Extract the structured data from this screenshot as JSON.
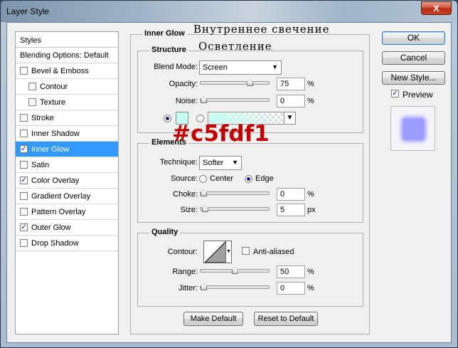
{
  "window": {
    "title": "Layer Style",
    "close_glyph": "X"
  },
  "styles_panel": {
    "header": "Styles",
    "items": [
      {
        "label": "Blending Options: Default",
        "has_checkbox": false,
        "checked": false,
        "indent": false,
        "selected": false
      },
      {
        "label": "Bevel & Emboss",
        "has_checkbox": true,
        "checked": false,
        "indent": false,
        "selected": false
      },
      {
        "label": "Contour",
        "has_checkbox": true,
        "checked": false,
        "indent": true,
        "selected": false
      },
      {
        "label": "Texture",
        "has_checkbox": true,
        "checked": false,
        "indent": true,
        "selected": false
      },
      {
        "label": "Stroke",
        "has_checkbox": true,
        "checked": false,
        "indent": false,
        "selected": false
      },
      {
        "label": "Inner Shadow",
        "has_checkbox": true,
        "checked": false,
        "indent": false,
        "selected": false
      },
      {
        "label": "Inner Glow",
        "has_checkbox": true,
        "checked": true,
        "indent": false,
        "selected": true
      },
      {
        "label": "Satin",
        "has_checkbox": true,
        "checked": false,
        "indent": false,
        "selected": false
      },
      {
        "label": "Color Overlay",
        "has_checkbox": true,
        "checked": true,
        "indent": false,
        "selected": false
      },
      {
        "label": "Gradient Overlay",
        "has_checkbox": true,
        "checked": false,
        "indent": false,
        "selected": false
      },
      {
        "label": "Pattern Overlay",
        "has_checkbox": true,
        "checked": false,
        "indent": false,
        "selected": false
      },
      {
        "label": "Outer Glow",
        "has_checkbox": true,
        "checked": true,
        "indent": false,
        "selected": false
      },
      {
        "label": "Drop Shadow",
        "has_checkbox": true,
        "checked": false,
        "indent": false,
        "selected": false
      }
    ]
  },
  "inner_glow": {
    "title": "Inner Glow",
    "structure": {
      "title": "Structure",
      "blend_mode_label": "Blend Mode:",
      "blend_mode_value": "Screen",
      "opacity_label": "Opacity:",
      "opacity_value": "75",
      "opacity_unit": "%",
      "opacity_level": 0.75,
      "noise_label": "Noise:",
      "noise_value": "0",
      "noise_unit": "%",
      "noise_level": 0,
      "glow_color": "#c5fdf1",
      "gradient_end": "#c5fdf1"
    },
    "elements": {
      "title": "Elements",
      "technique_label": "Technique:",
      "technique_value": "Softer",
      "source_label": "Source:",
      "source_center": "Center",
      "source_edge": "Edge",
      "source_selected": "Edge",
      "choke_label": "Choke:",
      "choke_value": "0",
      "choke_unit": "%",
      "choke_level": 0,
      "size_label": "Size:",
      "size_value": "5",
      "size_unit": "px",
      "size_level": 0.02
    },
    "quality": {
      "title": "Quality",
      "contour_label": "Contour:",
      "anti_aliased_label": "Anti-aliased",
      "anti_aliased_checked": false,
      "range_label": "Range:",
      "range_value": "50",
      "range_unit": "%",
      "range_level": 0.5,
      "jitter_label": "Jitter:",
      "jitter_value": "0",
      "jitter_unit": "%",
      "jitter_level": 0
    },
    "make_default_label": "Make Default",
    "reset_default_label": "Reset to Default"
  },
  "buttons": {
    "ok_label": "OK",
    "cancel_label": "Cancel",
    "new_style_label": "New Style...",
    "preview_label": "Preview",
    "preview_checked": true,
    "preview_swatch_color": "#9c9cff"
  },
  "annotations": {
    "title_ru": "Внутреннее свечение",
    "blend_ru": "Осветление",
    "hex_color": "#c5fdf1"
  },
  "colors": {
    "selection": "#3399ff",
    "hex_annotation": "#c00000"
  }
}
